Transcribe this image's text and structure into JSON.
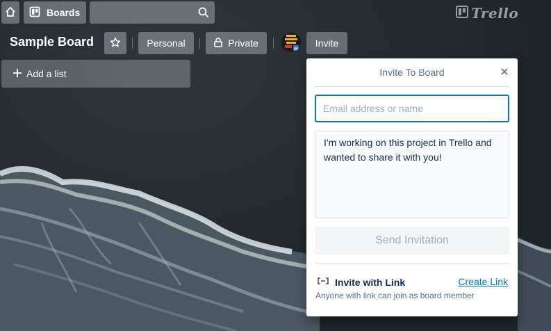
{
  "header": {
    "boards_label": "Boards",
    "search_placeholder": "",
    "logo_text": "Trello"
  },
  "board": {
    "title": "Sample Board",
    "team_label": "Personal",
    "visibility_label": "Private",
    "invite_label": "Invite",
    "add_list_label": "Add a list"
  },
  "invite_popover": {
    "title": "Invite To Board",
    "email_placeholder": "Email address or name",
    "message": "I'm working on this project in Trello and wanted to share it with you!",
    "send_label": "Send Invitation",
    "link_title": "Invite with Link",
    "create_link_label": "Create Link",
    "link_note": "Anyone with link can join as board member"
  },
  "colors": {
    "accent": "#0079bf",
    "header_button": "rgba(255,255,255,0.3)",
    "muted_text": "#5e6c84"
  },
  "icons": [
    "home-icon",
    "boards-icon",
    "search-icon",
    "star-icon",
    "lock-icon",
    "plus-icon",
    "close-icon",
    "link-icon",
    "trello-logo-icon"
  ]
}
